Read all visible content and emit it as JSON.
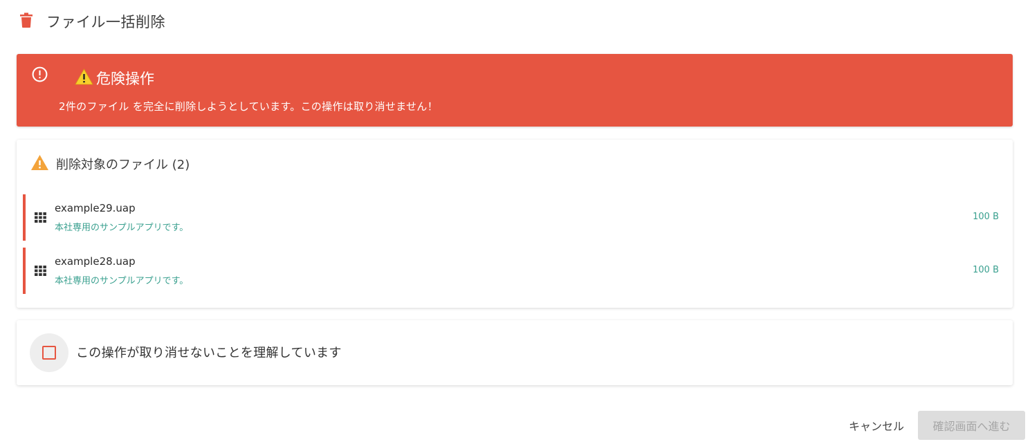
{
  "dialog": {
    "title": "ファイル一括削除",
    "title_icon": "trash-icon"
  },
  "alert": {
    "icon": "alert-circle-icon",
    "heading_icon": "warning-icon",
    "heading": "危険操作",
    "message": "2件のファイル を完全に削除しようとしています。この操作は取り消せません！"
  },
  "files": {
    "header": "削除対象のファイル (2)",
    "header_icon": "warning-icon",
    "items": [
      {
        "name": "example29.uap",
        "description": "本社専用のサンプルアプリです。",
        "size": "100 B",
        "icon": "apps-grid-icon"
      },
      {
        "name": "example28.uap",
        "description": "本社専用のサンプルアプリです。",
        "size": "100 B",
        "icon": "apps-grid-icon"
      }
    ]
  },
  "confirm": {
    "label": "この操作が取り消せないことを理解しています",
    "checked": false
  },
  "actions": {
    "cancel_label": "キャンセル",
    "next_label": "確認画面へ進む",
    "next_disabled": true
  },
  "colors": {
    "danger": "#e65541",
    "warning": "#f3a33a",
    "accent_text": "#3aa08f",
    "disabled_bg": "#dddddd"
  }
}
